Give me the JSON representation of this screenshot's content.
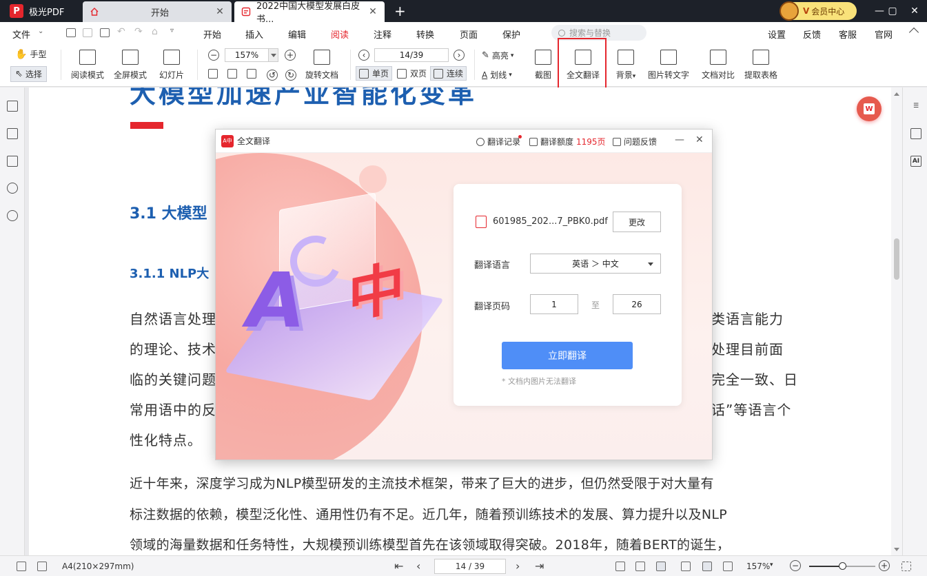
{
  "app": {
    "name": "极光PDF",
    "logo_letter": "P"
  },
  "tabs": [
    {
      "label": "开始",
      "active": false
    },
    {
      "label": "2022中国大模型发展白皮书...",
      "active": true
    }
  ],
  "window": {
    "vip_label": "会员中心",
    "vip_mark": "V"
  },
  "menu": {
    "file": "文件",
    "items": [
      "开始",
      "插入",
      "编辑",
      "阅读",
      "注释",
      "转换",
      "页面",
      "保护"
    ],
    "active": "阅读",
    "search_placeholder": "搜索与替换",
    "right_items": [
      "设置",
      "反馈",
      "客服",
      "官网"
    ]
  },
  "toolbar": {
    "hand": "手型",
    "select": "选择",
    "read_mode": "阅读模式",
    "fullscreen": "全屏模式",
    "slideshow": "幻灯片",
    "zoom_value": "157%",
    "rotate_doc": "旋转文档",
    "page_value": "14/39",
    "single_page": "单页",
    "double_page": "双页",
    "continuous": "连续",
    "highlight": "高亮",
    "underline": "划线",
    "screenshot": "截图",
    "full_translate": "全文翻译",
    "background": "背景",
    "img_to_text": "图片转文字",
    "doc_compare": "文档对比",
    "extract_table": "提取表格"
  },
  "document": {
    "heading_top": "大模型加速产业智能化变革",
    "heading_2": "3.1 大模型",
    "heading_3": "3.1.1 NLP大",
    "para1": [
      {
        "left": "自然语言处理",
        "right": "类语言能力"
      },
      {
        "left": "的理论、技术",
        "right": "处理目前面"
      },
      {
        "left": "临的关键问题",
        "right": "完全一致、日"
      },
      {
        "left": "常用语中的反",
        "right": "话”等语言个"
      },
      {
        "left": "性化特点。",
        "right": ""
      }
    ],
    "para2": [
      "近十年来，深度学习成为NLP模型研发的主流技术框架，带来了巨大的进步，但仍然受限于对大量有",
      "标注数据的依赖，模型泛化性、通用性仍有不足。近几年，随着预训练技术的发展、算力提升以及NLP",
      "领域的海量数据和任务特性，大规模预训练模型首先在该领域取得突破。2018年，随着BERT的诞生，"
    ]
  },
  "dialog": {
    "title": "全文翻译",
    "history": "翻译记录",
    "quota_label": "翻译额度",
    "quota_value": "1195页",
    "feedback": "问题反馈",
    "file_name": "601985_202...7_PBK0.pdf",
    "change_btn": "更改",
    "lang_label": "翻译语言",
    "lang_value": "英语 ＞ 中文",
    "pages_label": "翻译页码",
    "page_from": "1",
    "to": "至",
    "page_to": "26",
    "translate_btn": "立即翻译",
    "note": "* 文档内图片无法翻译",
    "illustration": {
      "left_glyph": "A",
      "right_glyph": "中"
    }
  },
  "statusbar": {
    "paper_size": "A4(210×297mm)",
    "page_value": "14 / 39",
    "zoom_value": "157%",
    "zoom_slider_fraction": 0.5
  },
  "sidebar_right": {
    "ai_label": "AI"
  },
  "colors": {
    "accent": "#e5262d",
    "primary_blue": "#4f8ef7",
    "heading_blue": "#1d5fb0"
  }
}
